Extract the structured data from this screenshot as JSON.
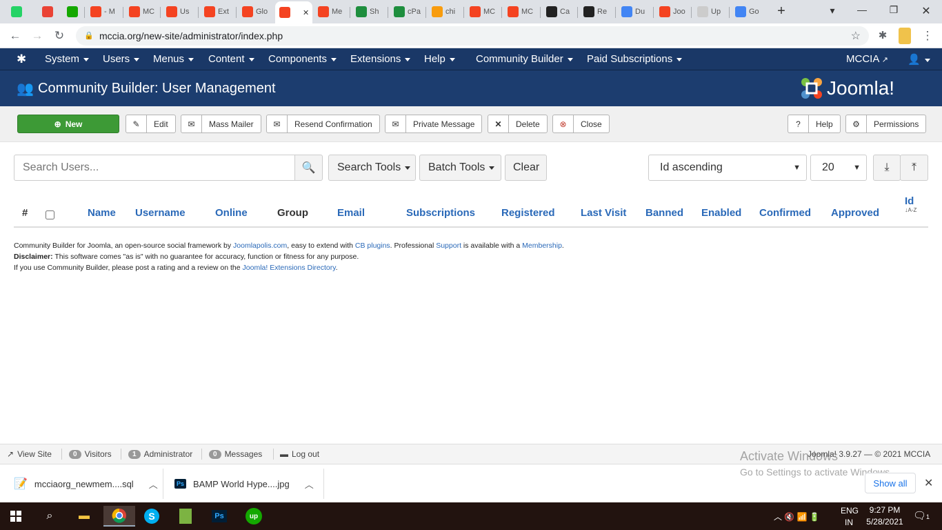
{
  "browser": {
    "tabs": [
      {
        "label": "",
        "favicon": "whatsapp-icon",
        "color": "#25d366"
      },
      {
        "label": "",
        "favicon": "gmail-icon",
        "color": "#ea4335"
      },
      {
        "label": "",
        "favicon": "upwork-icon",
        "color": "#14a800"
      },
      {
        "label": "- M",
        "favicon": "joomla-icon",
        "color": "#f44321"
      },
      {
        "label": "MC",
        "favicon": "joomla-icon",
        "color": "#f44321"
      },
      {
        "label": "Us",
        "favicon": "joomla-icon",
        "color": "#f44321"
      },
      {
        "label": "Ext",
        "favicon": "joomla-icon",
        "color": "#f44321"
      },
      {
        "label": "Glo",
        "favicon": "joomla-icon",
        "color": "#f44321"
      },
      {
        "label": "",
        "favicon": "joomla-icon",
        "color": "#f44321"
      },
      {
        "label": "Me",
        "favicon": "joomla-icon",
        "color": "#f44321"
      },
      {
        "label": "Sh",
        "favicon": "cpanel-plus-icon",
        "color": "#1e8e3e"
      },
      {
        "label": "cPa",
        "favicon": "cpanel-plus-icon",
        "color": "#1e8e3e"
      },
      {
        "label": "chi",
        "favicon": "phpmyadmin-icon",
        "color": "#f89c0e"
      },
      {
        "label": "MC",
        "favicon": "joomla-icon",
        "color": "#f44321"
      },
      {
        "label": "MC",
        "favicon": "joomla-icon",
        "color": "#f44321"
      },
      {
        "label": "Ca",
        "favicon": "yin-yang-icon",
        "color": "#222222"
      },
      {
        "label": "Re",
        "favicon": "yin-yang-icon",
        "color": "#222222"
      },
      {
        "label": "Du",
        "favicon": "google-icon",
        "color": "#4285f4"
      },
      {
        "label": "Joo",
        "favicon": "joomla-icon",
        "color": "#f44321"
      },
      {
        "label": "Up",
        "favicon": "globe-icon",
        "color": "#cccccc"
      },
      {
        "label": "Go",
        "favicon": "translate-icon",
        "color": "#4285f4"
      }
    ],
    "new_tab": "+",
    "url": "mccia.org/new-site/administrator/index.php"
  },
  "topmenu": {
    "items": [
      "System",
      "Users",
      "Menus",
      "Content",
      "Components",
      "Extensions",
      "Help",
      "Community Builder",
      "Paid Subscriptions"
    ],
    "site": "MCCIA"
  },
  "header": {
    "title": "Community Builder: User Management",
    "logo_text": "Joomla!"
  },
  "toolbar": {
    "new": "New",
    "edit": "Edit",
    "mass_mailer": "Mass Mailer",
    "resend": "Resend Confirmation",
    "private_message": "Private Message",
    "delete": "Delete",
    "close": "Close",
    "help": "Help",
    "permissions": "Permissions"
  },
  "filters": {
    "search_placeholder": "Search Users...",
    "search_tools": "Search Tools",
    "batch_tools": "Batch Tools",
    "clear": "Clear",
    "ordering": "Id ascending",
    "limit": "20"
  },
  "table": {
    "columns": [
      "#",
      "Name",
      "Username",
      "Online",
      "Group",
      "Email",
      "Subscriptions",
      "Registered",
      "Last Visit",
      "Banned",
      "Enabled",
      "Confirmed",
      "Approved",
      "Id"
    ],
    "sort_indicator": "A-Z"
  },
  "footer": {
    "line1_a": "Community Builder for Joomla, an open-source social framework by ",
    "line1_link1": "Joomlapolis.com",
    "line1_b": ", easy to extend with ",
    "line1_link2": "CB plugins",
    "line1_c": ". Professional ",
    "line1_link3": "Support",
    "line1_d": " is available with a ",
    "line1_link4": "Membership",
    "line1_e": ".",
    "line2_bold": "Disclaimer:",
    "line2_rest": " This software comes \"as is\" with no guarantee for accuracy, function or fitness for any purpose.",
    "line3_a": "If you use Community Builder, please post a rating and a review on the ",
    "line3_link": "Joomla! Extensions Directory",
    "line3_b": "."
  },
  "statusbar": {
    "view_site": "View Site",
    "visitors_count": "0",
    "visitors": "Visitors",
    "admin_count": "1",
    "administrator": "Administrator",
    "messages_count": "0",
    "messages": "Messages",
    "logout": "Log out",
    "version": "Joomla! 3.9.27 — © 2021 MCCIA"
  },
  "watermark": {
    "title": "Activate Windows",
    "subtitle": "Go to Settings to activate Windows."
  },
  "downloads": {
    "file1": "mcciaorg_newmem....sql",
    "file2": "BAMP World Hype....jpg",
    "show_all": "Show all"
  },
  "taskbar": {
    "lang1": "ENG",
    "lang2": "IN",
    "time": "9:27 PM",
    "date": "5/28/2021",
    "notif_count": "1"
  }
}
